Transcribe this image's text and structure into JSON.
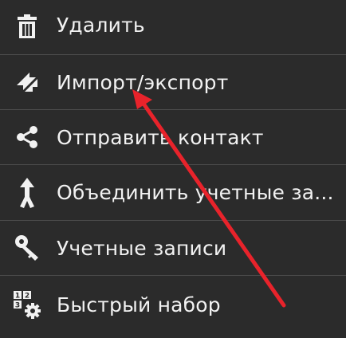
{
  "menu": {
    "items": [
      {
        "label": "Удалить",
        "icon": "trash-icon"
      },
      {
        "label": "Импорт/экспорт",
        "icon": "import-export-icon"
      },
      {
        "label": "Отправить контакт",
        "icon": "share-icon"
      },
      {
        "label": "Объединить учетные за...",
        "icon": "merge-icon"
      },
      {
        "label": "Учетные записи",
        "icon": "key-icon"
      },
      {
        "label": "Быстрый набор",
        "icon": "speed-dial-icon"
      }
    ]
  },
  "colors": {
    "background": "#2b2b2b",
    "text": "#f2f2f2",
    "divider": "#4b4b4b",
    "arrow": "#e8232b"
  }
}
